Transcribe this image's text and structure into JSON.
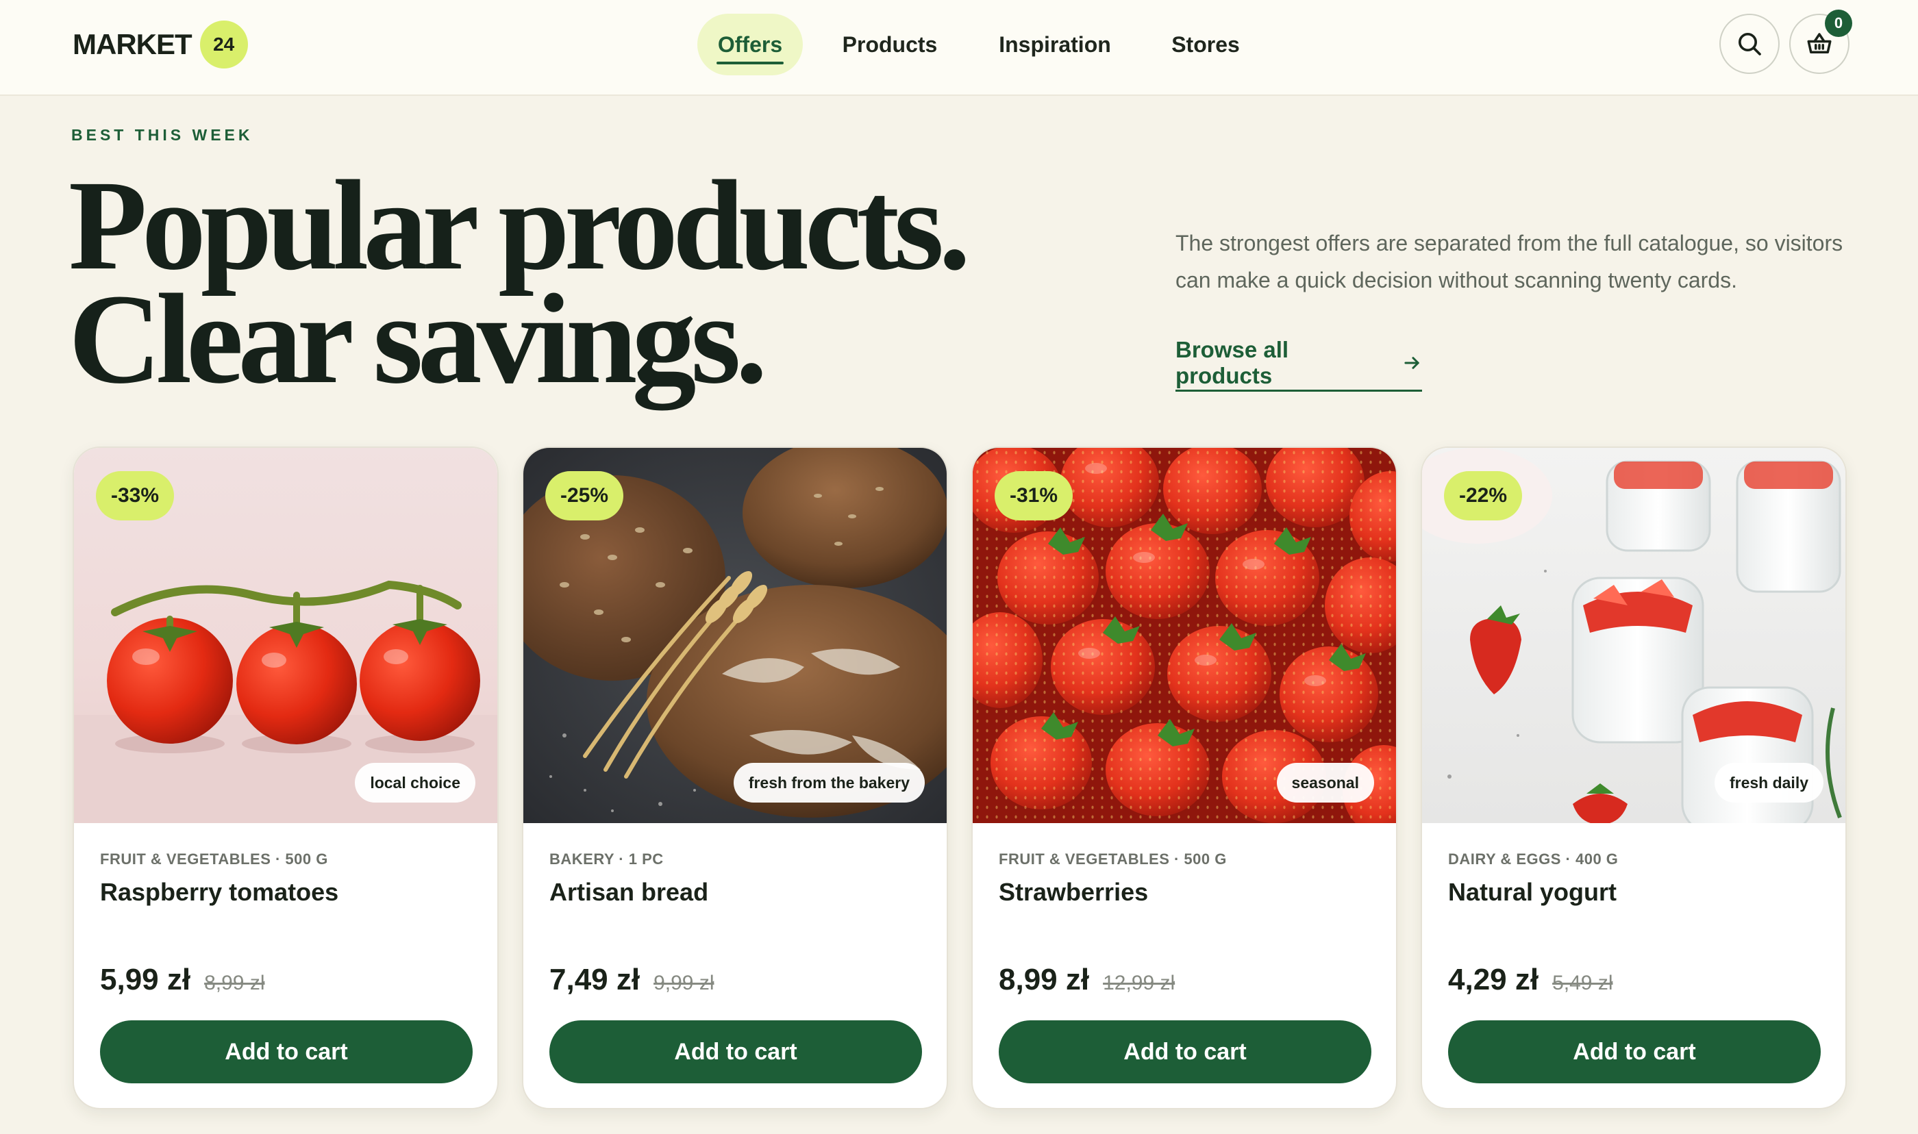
{
  "brand": {
    "name": "MARKET",
    "badge": "24"
  },
  "nav": {
    "items": [
      {
        "label": "Offers",
        "active": true
      },
      {
        "label": "Products",
        "active": false
      },
      {
        "label": "Inspiration",
        "active": false
      },
      {
        "label": "Stores",
        "active": false
      }
    ]
  },
  "header_actions": {
    "search_icon": "search-icon",
    "cart_icon": "basket-icon",
    "cart_count": "0"
  },
  "hero": {
    "eyebrow": "BEST THIS WEEK",
    "headline_line1": "Popular products.",
    "headline_line2": "Clear savings.",
    "description": "The strongest offers are separated from the full catalogue, so visitors can make a quick decision without scanning twenty cards.",
    "browse_label": "Browse all products",
    "browse_icon": "arrow-right-icon"
  },
  "colors": {
    "accent_green": "#1d5e37",
    "lime_badge": "#d9ef6b",
    "page_background": "#f6f3e9"
  },
  "products": [
    {
      "discount": "-33%",
      "tag": "local choice",
      "meta": "FRUIT & VEGETABLES · 500 G",
      "name": "Raspberry tomatoes",
      "price": "5,99 zł",
      "old_price": "8,99 zł",
      "button": "Add to cart",
      "image": "tomatoes-on-vine"
    },
    {
      "discount": "-25%",
      "tag": "fresh from the bakery",
      "meta": "BAKERY · 1 PC",
      "name": "Artisan bread",
      "price": "7,49 zł",
      "old_price": "9,99 zł",
      "button": "Add to cart",
      "image": "bread-loaves-with-wheat"
    },
    {
      "discount": "-31%",
      "tag": "seasonal",
      "meta": "FRUIT & VEGETABLES · 500 G",
      "name": "Strawberries",
      "price": "8,99 zł",
      "old_price": "12,99 zł",
      "button": "Add to cart",
      "image": "pile-of-strawberries"
    },
    {
      "discount": "-22%",
      "tag": "fresh daily",
      "meta": "DAIRY & EGGS · 400 G",
      "name": "Natural yogurt",
      "price": "4,29 zł",
      "old_price": "5,49 zł",
      "button": "Add to cart",
      "image": "yogurt-jars-with-strawberries"
    }
  ]
}
